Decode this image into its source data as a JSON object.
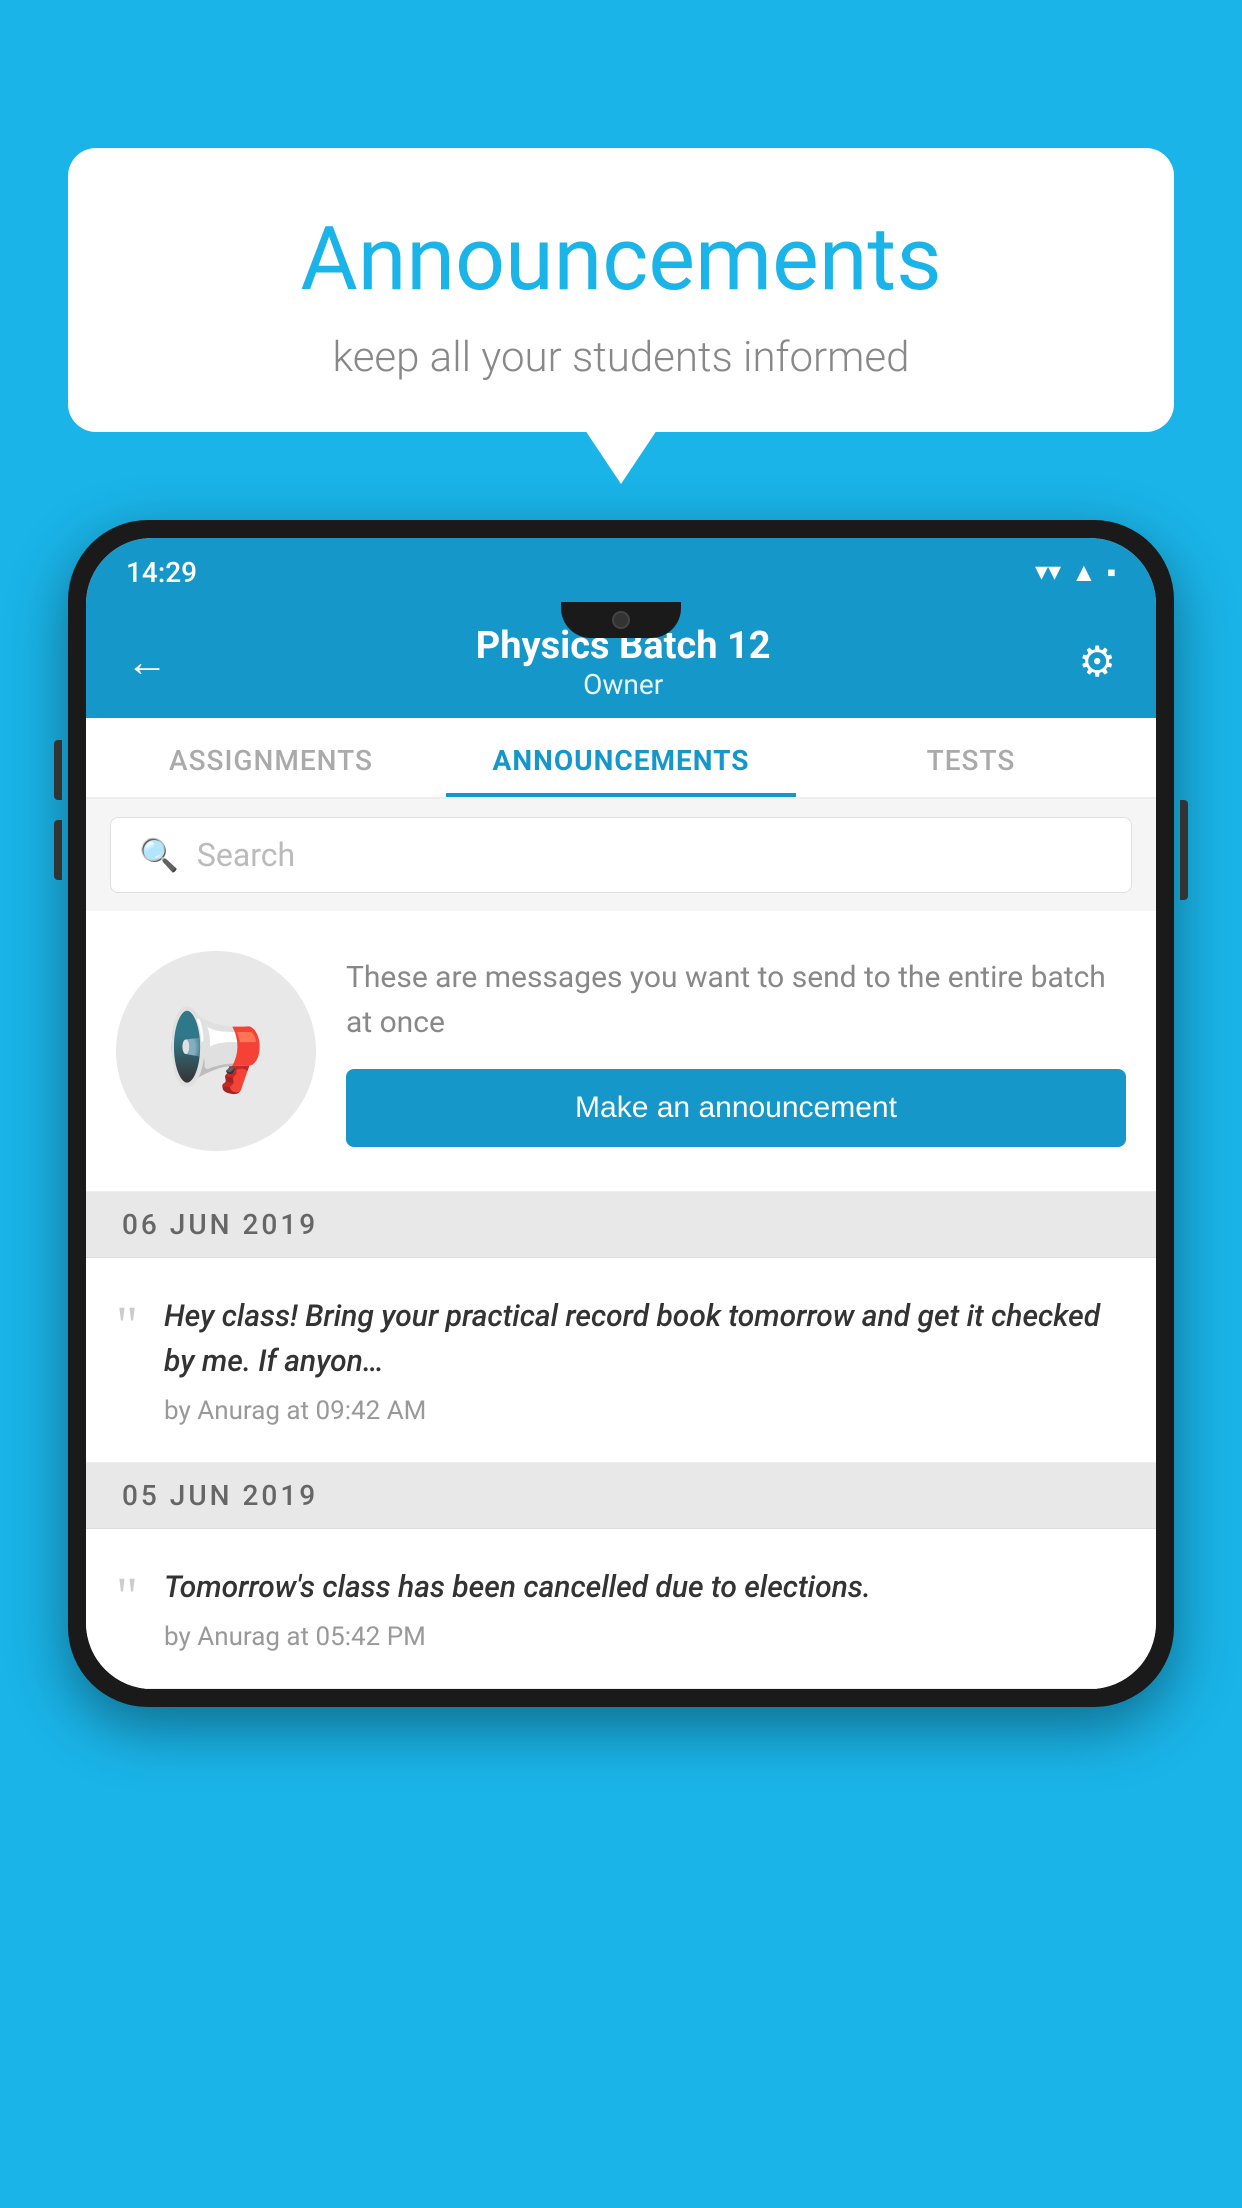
{
  "bubble": {
    "title": "Announcements",
    "subtitle": "keep all your students informed"
  },
  "status_bar": {
    "time": "14:29",
    "wifi": "▲",
    "signal": "▲",
    "battery": "▪"
  },
  "header": {
    "batch_name": "Physics Batch 12",
    "role": "Owner",
    "back_label": "←",
    "gear_label": "⚙"
  },
  "tabs": [
    {
      "label": "ASSIGNMENTS",
      "active": false
    },
    {
      "label": "ANNOUNCEMENTS",
      "active": true
    },
    {
      "label": "TESTS",
      "active": false
    }
  ],
  "search": {
    "placeholder": "Search"
  },
  "promo": {
    "description": "These are messages you want to send to the entire batch at once",
    "button_label": "Make an announcement"
  },
  "announcements": [
    {
      "date": "06  JUN  2019",
      "text": "Hey class! Bring your practical record book tomorrow and get it checked by me. If anyon…",
      "meta": "by Anurag at 09:42 AM"
    },
    {
      "date": "05  JUN  2019",
      "text": "Tomorrow's class has been cancelled due to elections.",
      "meta": "by Anurag at 05:42 PM"
    }
  ],
  "colors": {
    "primary": "#1597c9",
    "background": "#1ab4e8",
    "white": "#ffffff",
    "text_dark": "#333333",
    "text_muted": "#888888"
  }
}
